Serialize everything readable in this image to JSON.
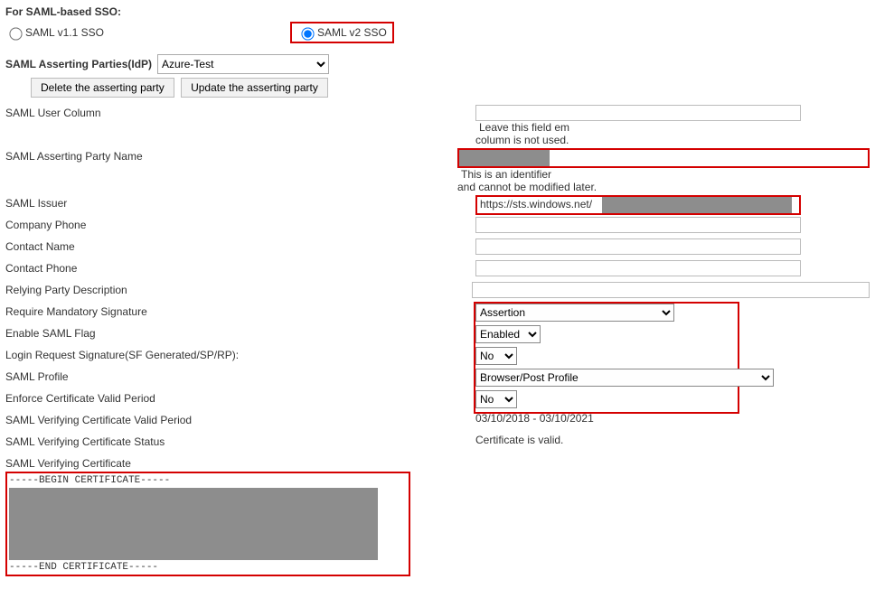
{
  "header": {
    "for_label": "For SAML-based SSO:",
    "radio_v11_label": "SAML v1.1 SSO",
    "radio_v2_label": "SAML v2 SSO"
  },
  "idp": {
    "label": "SAML Asserting Parties(IdP)",
    "selected": "Azure-Test"
  },
  "buttons": {
    "delete": "Delete the asserting party",
    "update": "Update the asserting party"
  },
  "rows": {
    "user_col": {
      "label": "SAML User Column",
      "value": "",
      "helper1": "Leave this field em",
      "helper2": "column is not used."
    },
    "party_name": {
      "label": "SAML Asserting Party Name",
      "helper1": "This is an identifier",
      "helper2": "and cannot be modified later."
    },
    "issuer": {
      "label": "SAML Issuer",
      "value": "https://sts.windows.net/"
    },
    "company_phone": {
      "label": "Company Phone",
      "value": ""
    },
    "contact_name": {
      "label": "Contact Name",
      "value": ""
    },
    "contact_phone": {
      "label": "Contact Phone",
      "value": ""
    },
    "relying_desc": {
      "label": "Relying Party Description",
      "value": ""
    },
    "req_sig": {
      "label": "Require Mandatory Signature",
      "value": "Assertion"
    },
    "saml_flag": {
      "label": "Enable SAML Flag",
      "value": "Enabled"
    },
    "login_sig": {
      "label": "Login Request Signature(SF Generated/SP/RP):",
      "value": "No"
    },
    "profile": {
      "label": "SAML Profile",
      "value": "Browser/Post Profile"
    },
    "enforce_valid": {
      "label": "Enforce Certificate Valid Period",
      "value": "No"
    },
    "cert_period": {
      "label": "SAML Verifying Certificate Valid Period",
      "value": "03/10/2018 - 03/10/2021"
    },
    "cert_status": {
      "label": "SAML Verifying Certificate Status",
      "value": "Certificate is valid."
    },
    "cert": {
      "label": "SAML Verifying Certificate",
      "begin": "-----BEGIN CERTIFICATE-----",
      "end": "-----END CERTIFICATE-----"
    }
  }
}
